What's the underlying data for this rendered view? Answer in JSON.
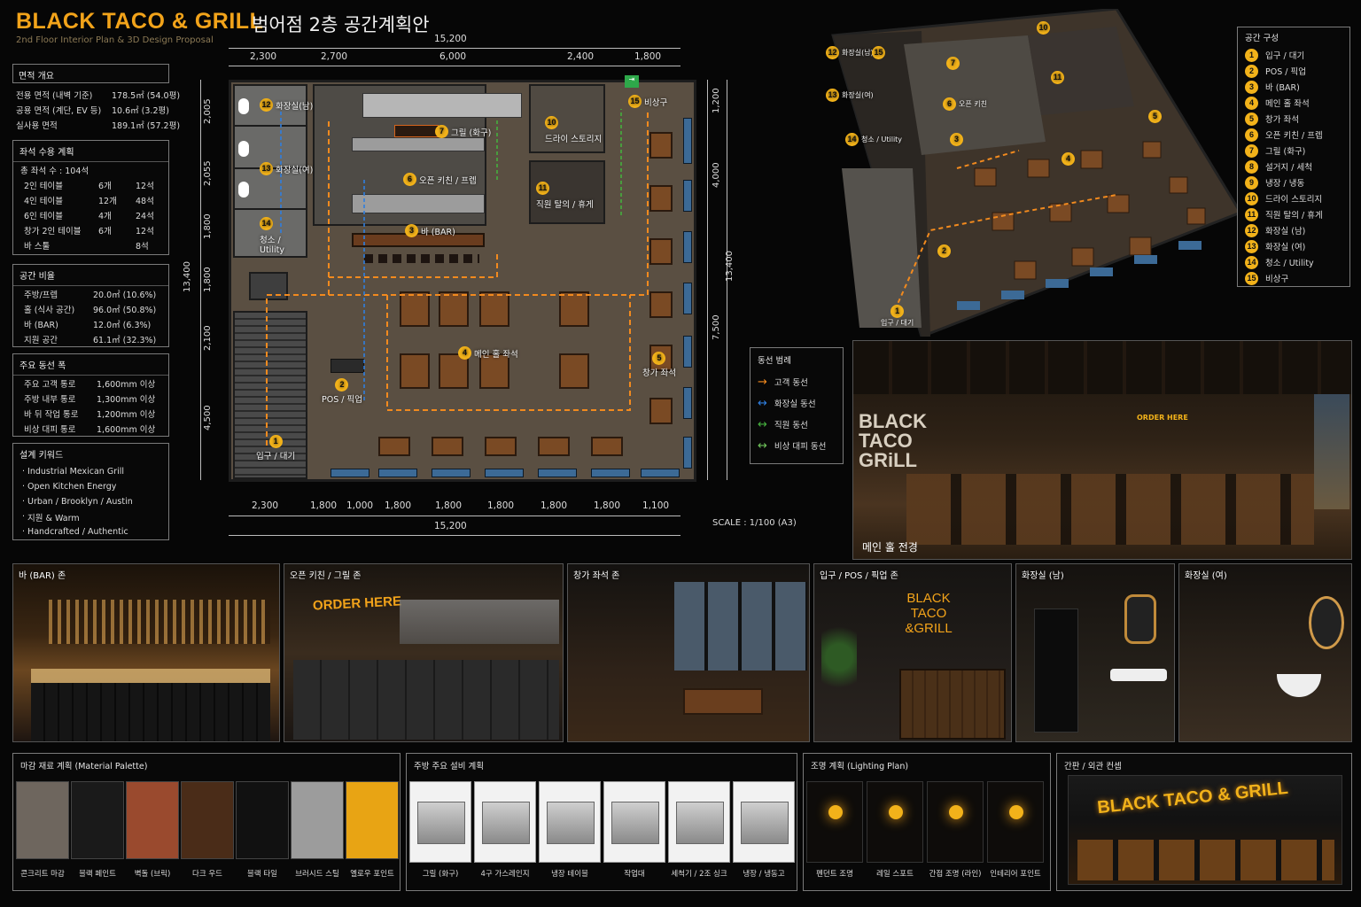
{
  "header": {
    "title": "BLACK TACO & GRILL",
    "title_ko": "범어점 2층 공간계획안",
    "subtitle": "2nd Floor Interior Plan & 3D Design Proposal"
  },
  "area": {
    "heading": "면적 개요",
    "rows": [
      {
        "label": "전용 면적 (내벽 기준)",
        "value": "178.5㎡ (54.0평)"
      },
      {
        "label": "공용 면적 (계단, EV 등)",
        "value": "10.6㎡  (3.2평)"
      },
      {
        "label": "실사용 면적",
        "value": "189.1㎡ (57.2평)"
      }
    ]
  },
  "seating": {
    "heading": "좌석 수용 계획",
    "total": "총 좌석 수 : 104석",
    "rows": [
      {
        "type": "2인 테이블",
        "count": "6개",
        "seats": "12석"
      },
      {
        "type": "4인 테이블",
        "count": "12개",
        "seats": "48석"
      },
      {
        "type": "6인 테이블",
        "count": "4개",
        "seats": "24석"
      },
      {
        "type": "창가 2인 테이블",
        "count": "6개",
        "seats": "12석"
      },
      {
        "type": "바 스툴",
        "count": "",
        "seats": "8석"
      }
    ]
  },
  "ratio": {
    "heading": "공간 비율",
    "rows": [
      {
        "label": "주방/프렙",
        "value": "20.0㎡ (10.6%)"
      },
      {
        "label": "홀 (식사 공간)",
        "value": "96.0㎡ (50.8%)"
      },
      {
        "label": "바 (BAR)",
        "value": "12.0㎡  (6.3%)"
      },
      {
        "label": "지원 공간",
        "value": "61.1㎡ (32.3%)"
      }
    ]
  },
  "circulation": {
    "heading": "주요 동선 폭",
    "rows": [
      {
        "label": "주요 고객 통로",
        "value": "1,600mm 이상"
      },
      {
        "label": "주방 내부 통로",
        "value": "1,300mm 이상"
      },
      {
        "label": "바 뒤 작업 통로",
        "value": "1,200mm 이상"
      },
      {
        "label": "비상 대피 통로",
        "value": "1,600mm 이상"
      }
    ]
  },
  "keywords": {
    "heading": "설계 키워드",
    "items": [
      "Industrial Mexican Grill",
      "Open Kitchen Energy",
      "Urban / Brooklyn / Austin",
      "지원 & Warm",
      "Handcrafted / Authentic"
    ]
  },
  "plan": {
    "dims_top": {
      "total": "15,200",
      "parts": [
        "2,300",
        "2,700",
        "6,000",
        "2,400",
        "1,800"
      ]
    },
    "dims_bottom": {
      "total": "15,200",
      "parts": [
        "2,300",
        "1,800",
        "1,000",
        "1,800",
        "1,800",
        "1,800",
        "1,800",
        "1,800",
        "1,100"
      ]
    },
    "dims_left": {
      "total": "13,400",
      "parts": [
        "2,005",
        "2,055",
        "1,800",
        "1,800",
        "2,100",
        "4,500"
      ]
    },
    "dims_right": {
      "total": "13,400",
      "parts": [
        "1,200",
        "4,000",
        "7,500"
      ]
    },
    "scale": "SCALE : 1/100 (A3)",
    "labels": [
      {
        "n": "1",
        "text": "입구 / 대기"
      },
      {
        "n": "2",
        "text": "POS / 픽업"
      },
      {
        "n": "3",
        "text": "바 (BAR)"
      },
      {
        "n": "4",
        "text": "메인 홀 좌석"
      },
      {
        "n": "5",
        "text": "창가 좌석"
      },
      {
        "n": "6",
        "text": "오픈 키친 / 프렙"
      },
      {
        "n": "7",
        "text": "그릴 (화구)"
      },
      {
        "n": "10",
        "text": "드라이 스토리지"
      },
      {
        "n": "11",
        "text": "직원 탈의 / 휴게"
      },
      {
        "n": "12",
        "text": "화장실(남)"
      },
      {
        "n": "13",
        "text": "화장실(여)"
      },
      {
        "n": "14",
        "text": "청소 / Utility"
      },
      {
        "n": "15",
        "text": "비상구"
      }
    ]
  },
  "legend": {
    "heading": "동선 범례",
    "items": [
      {
        "label": "고객 동선",
        "color": "#f28a1e"
      },
      {
        "label": "화장실 동선",
        "color": "#2f7fe0"
      },
      {
        "label": "직원 동선",
        "color": "#45b03e"
      },
      {
        "label": "비상 대피 동선",
        "color": "#6ec25a"
      }
    ]
  },
  "rooms": {
    "heading": "공간 구성",
    "items": [
      {
        "n": "1",
        "label": "입구 / 대기"
      },
      {
        "n": "2",
        "label": "POS / 픽업"
      },
      {
        "n": "3",
        "label": "바 (BAR)"
      },
      {
        "n": "4",
        "label": "메인 홀 좌석"
      },
      {
        "n": "5",
        "label": "창가 좌석"
      },
      {
        "n": "6",
        "label": "오픈 키친 / 프렙"
      },
      {
        "n": "7",
        "label": "그릴 (화구)"
      },
      {
        "n": "8",
        "label": "설거지 / 세척"
      },
      {
        "n": "9",
        "label": "냉장 / 냉동"
      },
      {
        "n": "10",
        "label": "드라이 스토리지"
      },
      {
        "n": "11",
        "label": "직원 탈의 / 휴게"
      },
      {
        "n": "12",
        "label": "화장실 (남)"
      },
      {
        "n": "13",
        "label": "화장실 (여)"
      },
      {
        "n": "14",
        "label": "청소 / Utility"
      },
      {
        "n": "15",
        "label": "비상구"
      }
    ]
  },
  "iso_labels": {
    "toilet_m": "화장실(남)",
    "toilet_f": "화장실(여)",
    "utility": "청소 / Utility",
    "kitchen": "오픈 키친",
    "entry": "입구 / 대기"
  },
  "main_photo": {
    "caption": "메인 홀 전경",
    "wall_text": "BLACK TACO GRiLL",
    "order_sign": "ORDER HERE"
  },
  "photos": [
    {
      "caption": "바 (BAR) 존"
    },
    {
      "caption": "오픈 키친 / 그릴 존",
      "sign": "ORDER HERE"
    },
    {
      "caption": "창가 좌석 존"
    },
    {
      "caption": "입구 / POS / 픽업 존",
      "sign": "BLACK TACO &GRILL"
    },
    {
      "caption": "화장실 (남)"
    },
    {
      "caption": "화장실 (여)"
    }
  ],
  "materials": {
    "heading": "마감 재료 계획 (Material Palette)",
    "items": [
      {
        "label": "콘크리트 마감",
        "color": "#6e665e"
      },
      {
        "label": "블랙 페인트",
        "color": "#1a1a1a"
      },
      {
        "label": "벽돌 (브릭)",
        "color": "#9a4a2e"
      },
      {
        "label": "다크 우드",
        "color": "#4a2c18"
      },
      {
        "label": "블랙 타일",
        "color": "#111111"
      },
      {
        "label": "브러시드 스틸",
        "color": "#9c9c9c"
      },
      {
        "label": "옐로우 포인트",
        "color": "#e8a414"
      }
    ]
  },
  "equipment": {
    "heading": "주방 주요 설비 계획",
    "items": [
      "그릴 (화구)",
      "4구 가스레인지",
      "냉장 테이블",
      "작업대",
      "세척기 / 2조 싱크",
      "냉장 / 냉동고"
    ]
  },
  "lighting": {
    "heading": "조명 계획 (Lighting Plan)",
    "items": [
      "펜던트 조명",
      "레일 스포트",
      "간접 조명 (라인)",
      "인테리어 포인트"
    ]
  },
  "facade": {
    "heading": "간판 / 외관 컨셉",
    "sign": "BLACK TACO & GRILL"
  }
}
